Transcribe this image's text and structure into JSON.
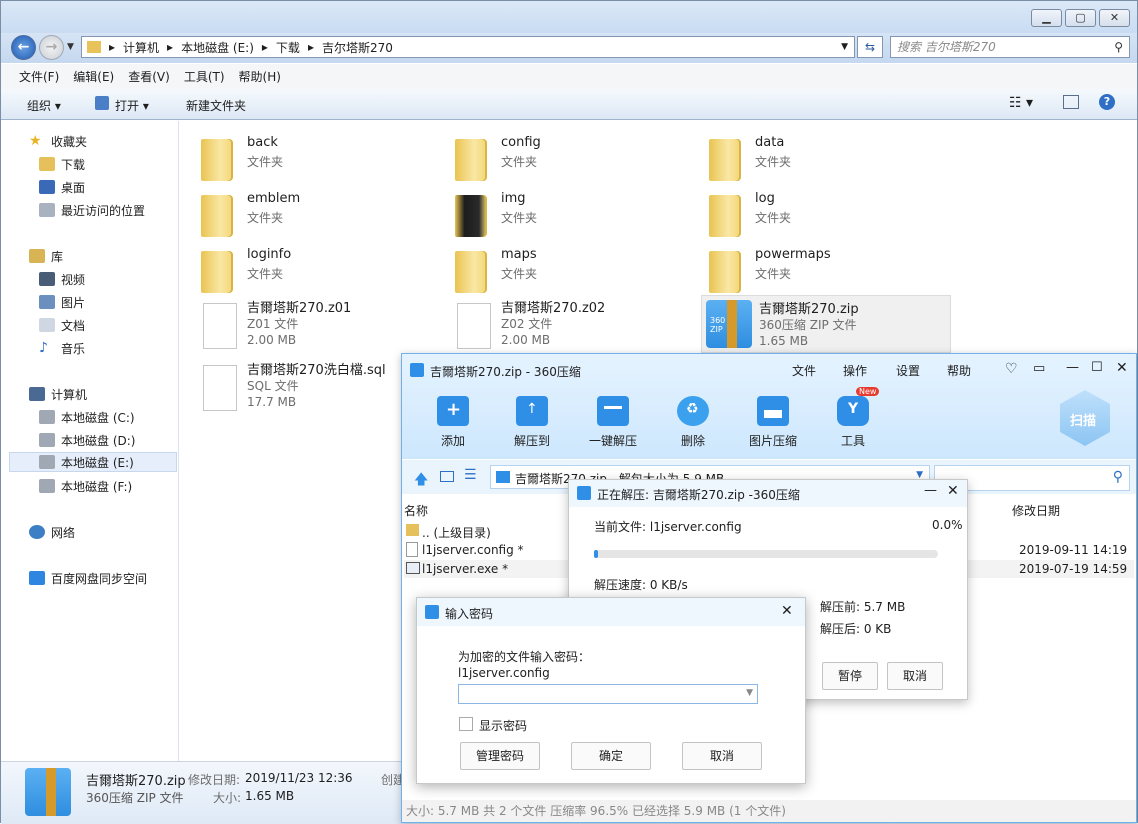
{
  "explorer": {
    "breadcrumb": [
      "计算机",
      "本地磁盘 (E:)",
      "下载",
      "吉尔塔斯270"
    ],
    "search_placeholder": "搜索 吉尔塔斯270",
    "menu": [
      "文件(F)",
      "编辑(E)",
      "查看(V)",
      "工具(T)",
      "帮助(H)"
    ],
    "toolbar": {
      "organize": "组织",
      "open": "打开",
      "new_folder": "新建文件夹"
    },
    "nav": {
      "favorites": "收藏夹",
      "fav_items": [
        "下载",
        "桌面",
        "最近访问的位置"
      ],
      "libraries": "库",
      "lib_items": [
        "视频",
        "图片",
        "文档",
        "音乐"
      ],
      "computer": "计算机",
      "drives": [
        "本地磁盘 (C:)",
        "本地磁盘 (D:)",
        "本地磁盘 (E:)",
        "本地磁盘 (F:)"
      ],
      "network": "网络",
      "baidu": "百度网盘同步空间"
    },
    "items": [
      {
        "name": "back",
        "type": "文件夹"
      },
      {
        "name": "config",
        "type": "文件夹"
      },
      {
        "name": "data",
        "type": "文件夹"
      },
      {
        "name": "emblem",
        "type": "文件夹"
      },
      {
        "name": "img",
        "type": "文件夹"
      },
      {
        "name": "log",
        "type": "文件夹"
      },
      {
        "name": "loginfo",
        "type": "文件夹"
      },
      {
        "name": "maps",
        "type": "文件夹"
      },
      {
        "name": "powermaps",
        "type": "文件夹"
      },
      {
        "name": "吉爾塔斯270.z01",
        "type": "Z01 文件",
        "size": "2.00 MB"
      },
      {
        "name": "吉爾塔斯270.z02",
        "type": "Z02 文件",
        "size": "2.00 MB"
      },
      {
        "name": "吉爾塔斯270.zip",
        "type": "360压缩 ZIP 文件",
        "size": "1.65 MB"
      },
      {
        "name": "吉爾塔斯270洗白檔.sql",
        "type": "SQL 文件",
        "size": "17.7 MB"
      }
    ],
    "details": {
      "name": "吉爾塔斯270.zip",
      "modified_label": "修改日期:",
      "modified": "2019/11/23 12:36",
      "created_label": "创建",
      "type": "360压缩 ZIP 文件",
      "size_label": "大小:",
      "size": "1.65 MB"
    }
  },
  "z360": {
    "title": "吉爾塔斯270.zip - 360压缩",
    "menu": [
      "文件",
      "操作",
      "设置",
      "帮助"
    ],
    "tools": [
      "添加",
      "解压到",
      "一键解压",
      "删除",
      "图片压缩",
      "工具"
    ],
    "new_badge": "New",
    "scan": "扫描",
    "path": "吉爾塔斯270.zip - 解包大小为 5.9 MB",
    "col_name": "名称",
    "col_date": "修改日期",
    "files": [
      {
        "name": ".. (上级目录)",
        "date": ""
      },
      {
        "name": "l1jserver.config *",
        "date": "2019-09-11 14:19"
      },
      {
        "name": "l1jserver.exe *",
        "date": "2019-07-19 14:59"
      }
    ],
    "status": "大小: 5.7 MB 共 2 个文件 压缩率 96.5% 已经选择 5.9 MB (1 个文件)"
  },
  "progress": {
    "title": "正在解压: 吉爾塔斯270.zip -360压缩",
    "current_label": "当前文件: l1jserver.config",
    "percent": "0.0%",
    "percent_value": 0,
    "speed": "解压速度: 0 KB/s",
    "before": "解压前: 5.7 MB",
    "after": "解压后: 0 KB",
    "pause": "暂停",
    "cancel": "取消"
  },
  "password": {
    "title": "输入密码",
    "prompt": "为加密的文件输入密码：",
    "file": "l1jserver.config",
    "show": "显示密码",
    "manage": "管理密码",
    "ok": "确定",
    "cancel": "取消"
  }
}
